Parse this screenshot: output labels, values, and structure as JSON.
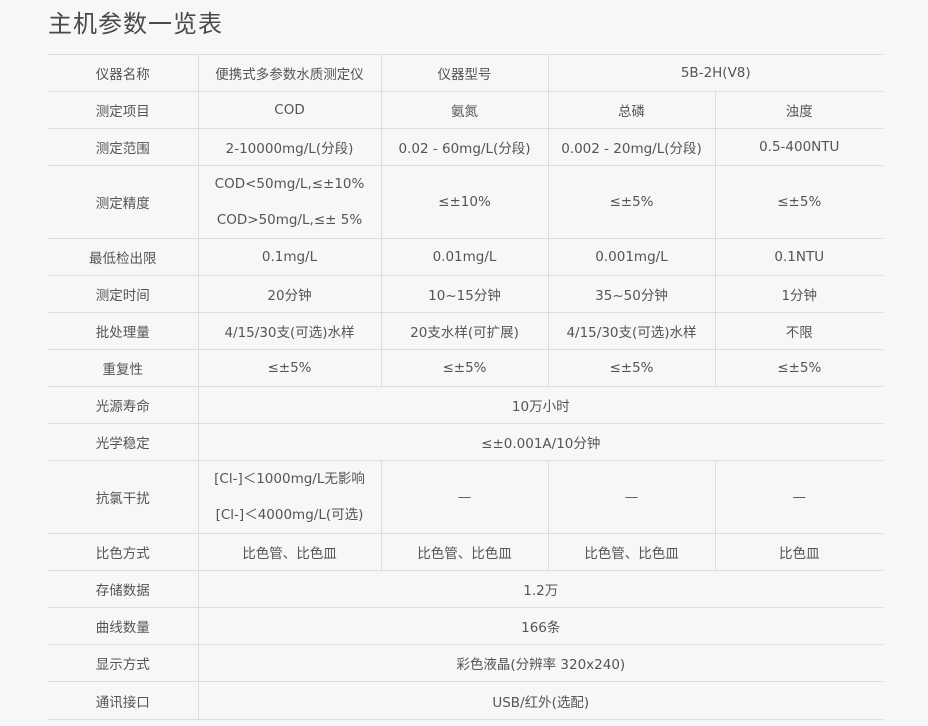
{
  "title": "主机参数一览表",
  "rows": [
    {
      "label": "仪器名称",
      "c1": "便携式多参数水质测定仪",
      "c2": "仪器型号",
      "c3": "5B-2H(V8)"
    },
    {
      "label": "测定项目",
      "c1": "COD",
      "c2": "氨氮",
      "c3": "总磷",
      "c4": "浊度"
    },
    {
      "label": "测定范围",
      "c1": "2-10000mg/L(分段)",
      "c2": "0.02 - 60mg/L(分段)",
      "c3": "0.002 - 20mg/L(分段)",
      "c4": "0.5-400NTU"
    },
    {
      "label": "测定精度",
      "c1a": "COD<50mg/L,≤±10%",
      "c1b": "COD>50mg/L,≤± 5%",
      "c2": "≤±10%",
      "c3": "≤±5%",
      "c4": "≤±5%"
    },
    {
      "label": "最低检出限",
      "c1": "0.1mg/L",
      "c2": "0.01mg/L",
      "c3": "0.001mg/L",
      "c4": "0.1NTU"
    },
    {
      "label": "测定时间",
      "c1": "20分钟",
      "c2": "10~15分钟",
      "c3": "35~50分钟",
      "c4": "1分钟"
    },
    {
      "label": "批处理量",
      "c1": "4/15/30支(可选)水样",
      "c2": "20支水样(可扩展)",
      "c3": "4/15/30支(可选)水样",
      "c4": "不限"
    },
    {
      "label": "重复性",
      "c1": "≤±5%",
      "c2": "≤±5%",
      "c3": "≤±5%",
      "c4": "≤±5%"
    },
    {
      "label": "光源寿命",
      "value": "10万小时"
    },
    {
      "label": "光学稳定",
      "value": "≤±0.001A/10分钟"
    },
    {
      "label": "抗氯干扰",
      "c1a": "[Cl-]＜1000mg/L无影响",
      "c1b": "[Cl-]＜4000mg/L(可选)",
      "c2": "—",
      "c3": "—",
      "c4": "—"
    },
    {
      "label": "比色方式",
      "c1": "比色管、比色皿",
      "c2": "比色管、比色皿",
      "c3": "比色管、比色皿",
      "c4": "比色皿"
    },
    {
      "label": "存储数据",
      "value": "1.2万"
    },
    {
      "label": "曲线数量",
      "value": "166条"
    },
    {
      "label": "显示方式",
      "value": "彩色液晶(分辨率 320x240)"
    },
    {
      "label": "通讯接口",
      "value": "USB/红外(选配)"
    }
  ]
}
